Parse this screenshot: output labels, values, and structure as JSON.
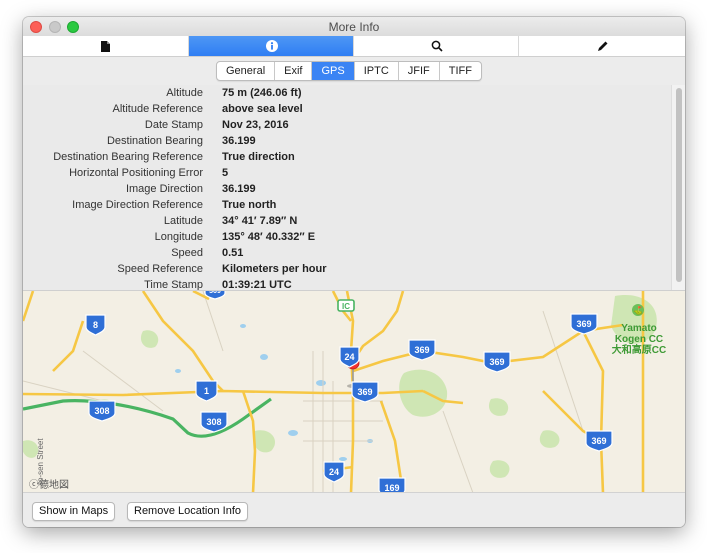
{
  "window": {
    "title": "More Info"
  },
  "toolbar": {
    "items": [
      {
        "icon": "document-icon"
      },
      {
        "icon": "info-icon",
        "selected": true
      },
      {
        "icon": "magnifier-icon"
      },
      {
        "icon": "pencil-icon"
      }
    ]
  },
  "tabs": [
    "General",
    "Exif",
    "GPS",
    "IPTC",
    "JFIF",
    "TIFF"
  ],
  "active_tab": "GPS",
  "gps": {
    "rows": [
      {
        "key": "Altitude",
        "value": "75 m (246.06 ft)"
      },
      {
        "key": "Altitude Reference",
        "value": "above sea level"
      },
      {
        "key": "Date Stamp",
        "value": "Nov 23, 2016"
      },
      {
        "key": "Destination Bearing",
        "value": "36.199"
      },
      {
        "key": "Destination Bearing Reference",
        "value": "True direction"
      },
      {
        "key": "Horizontal Positioning Error",
        "value": "5"
      },
      {
        "key": "Image Direction",
        "value": "36.199"
      },
      {
        "key": "Image Direction Reference",
        "value": "True north"
      },
      {
        "key": "Latitude",
        "value": "34° 41′ 7.89″ N"
      },
      {
        "key": "Longitude",
        "value": "135° 48′ 40.332″ E"
      },
      {
        "key": "Speed",
        "value": "0.51"
      },
      {
        "key": "Speed Reference",
        "value": "Kilometers per hour"
      },
      {
        "key": "Time Stamp",
        "value": "01:39:21 UTC"
      }
    ]
  },
  "map": {
    "shields": [
      "8",
      "1",
      "308",
      "308",
      "24",
      "24",
      "369",
      "369",
      "369",
      "369",
      "369",
      "369",
      "169"
    ],
    "poi_en_1": "Yamato",
    "poi_en_2": "Kogen CC",
    "poi_jp": "大和高原CC",
    "street_label": "Jo-sen Street",
    "attribution": "ⓒ德地図",
    "ic_label": "IC"
  },
  "buttons": {
    "show_in_maps": "Show in Maps",
    "remove_location": "Remove Location Info"
  },
  "colors": {
    "accent": "#3b84f4",
    "shield": "#2f6fd6",
    "highway": "#4bb565",
    "road": "#f6c744",
    "pin": "#f2312d"
  }
}
